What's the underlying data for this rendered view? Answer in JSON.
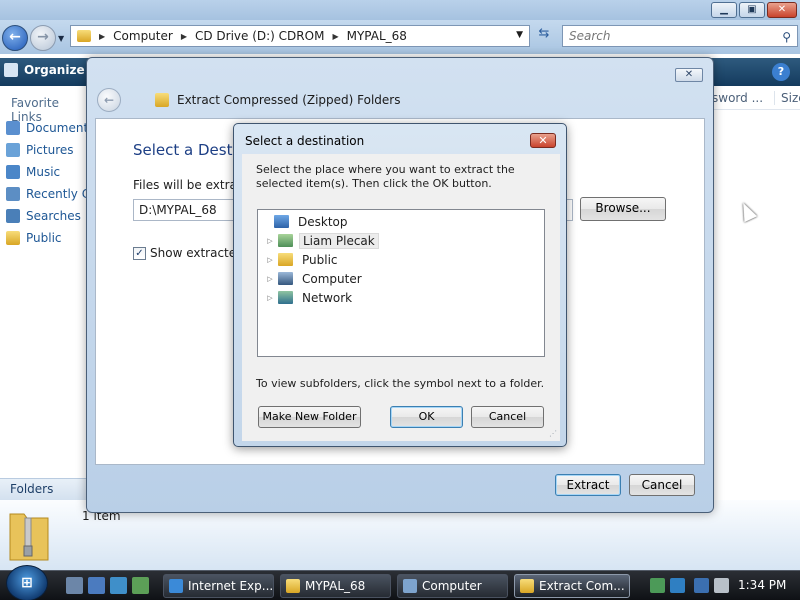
{
  "explorer": {
    "breadcrumbs": [
      "Computer",
      "CD Drive (D:) CDROM",
      "MYPAL_68"
    ],
    "search_placeholder": "Search",
    "organize_label": "Organize",
    "favorite_links_title": "Favorite Links",
    "favorite_links": [
      "Documents",
      "Pictures",
      "Music",
      "Recently C",
      "Searches",
      "Public"
    ],
    "folders_label": "Folders",
    "columns": [
      "sword ...",
      "Size"
    ],
    "item_count": "1 item"
  },
  "extract_wizard": {
    "title": "Extract Compressed (Zipped) Folders",
    "heading": "Select a Destin",
    "files_label": "Files will be extracte",
    "path_value": "D:\\MYPAL_68",
    "browse_label": "Browse...",
    "show_extracted_label": "Show extracted f",
    "show_extracted_checked": true,
    "extract_label": "Extract",
    "cancel_label": "Cancel"
  },
  "destination_dialog": {
    "title": "Select a destination",
    "instructions": "Select the place where you want to extract the selected item(s).  Then click the OK button.",
    "tree": [
      {
        "label": "Desktop",
        "icon": "desktop-icon",
        "expandable": false
      },
      {
        "label": "Liam Plecak",
        "icon": "user-folder-icon",
        "expandable": true,
        "highlighted": true
      },
      {
        "label": "Public",
        "icon": "folder-icon",
        "expandable": true
      },
      {
        "label": "Computer",
        "icon": "computer-icon",
        "expandable": true
      },
      {
        "label": "Network",
        "icon": "network-icon",
        "expandable": true
      }
    ],
    "hint": "To view subfolders, click the symbol next to a folder.",
    "new_folder_label": "Make New Folder",
    "ok_label": "OK",
    "cancel_label": "Cancel"
  },
  "taskbar": {
    "tasks": [
      "Internet Exp...",
      "MYPAL_68",
      "Computer",
      "Extract Com..."
    ],
    "active_task": "Extract Com...",
    "clock": "1:34 PM"
  },
  "colors": {
    "command_bar": "#1f4a70",
    "wizard_heading": "#1d3f85",
    "close_button_red": "#c9432d",
    "taskbar": "#1a1d22"
  }
}
